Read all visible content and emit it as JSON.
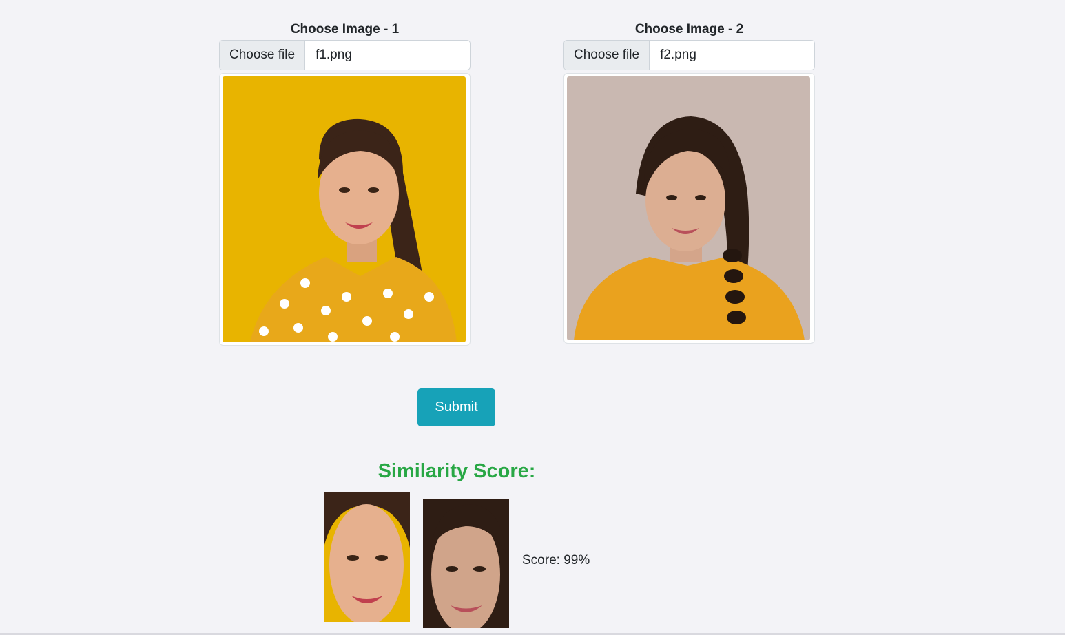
{
  "uploads": [
    {
      "label": "Choose Image - 1",
      "button": "Choose file",
      "file_name": "f1.png",
      "background_color": "#e8b400",
      "shirt_color": "#e8a81a"
    },
    {
      "label": "Choose Image - 2",
      "button": "Choose file",
      "file_name": "f2.png",
      "background_color": "#c9b8b1",
      "shirt_color": "#eaa21e"
    }
  ],
  "submit_label": "Submit",
  "result": {
    "title": "Similarity Score:",
    "score_text": "Score: 99%"
  },
  "colors": {
    "accent": "#17a2b8",
    "success": "#28a745",
    "page_background": "#f3f3f7"
  }
}
